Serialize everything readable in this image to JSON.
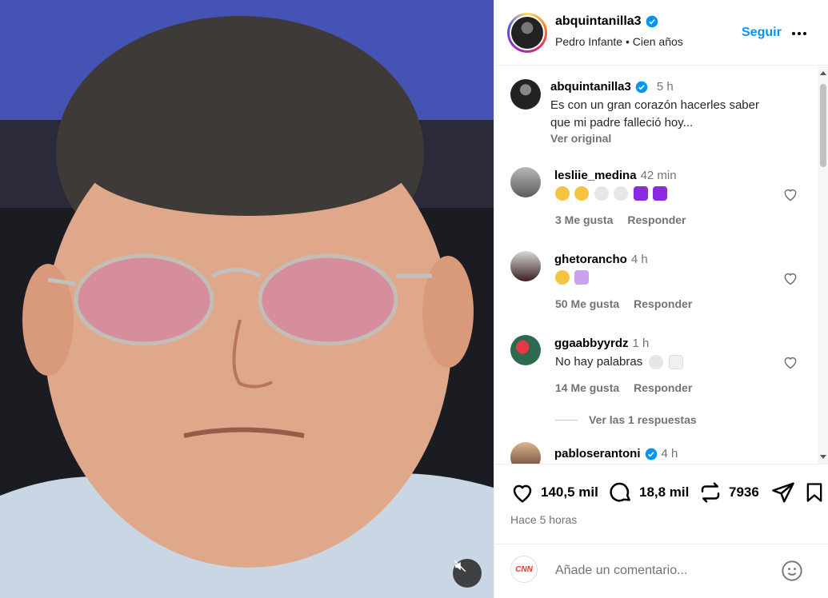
{
  "post": {
    "username": "abquintanilla3",
    "subtitle": "Pedro Infante • Cien años",
    "follow_label": "Seguir",
    "caption_user": "abquintanilla3",
    "caption_time": "5 h",
    "caption_text_1": "Es con un gran corazón hacerles saber",
    "caption_text_2": "que mi padre falleció hoy...",
    "see_original": "Ver original",
    "media_badge": "CNN"
  },
  "comments": [
    {
      "user": "lesliie_medina",
      "time": "42 min",
      "likes": "3 Me gusta",
      "reply": "Responder"
    },
    {
      "user": "ghetorancho",
      "time": "4 h",
      "likes": "50 Me gusta",
      "reply": "Responder"
    },
    {
      "user": "ggaabbyyrdz",
      "time": "1 h",
      "text": "No hay palabras",
      "likes": "14 Me gusta",
      "reply": "Responder"
    },
    {
      "user": "pabloserantoni",
      "time": "4 h"
    }
  ],
  "replies_label": "Ver las 1 respuestas",
  "stats": {
    "likes": "140,5 mil",
    "comments": "18,8 mil",
    "reposts": "7936",
    "posted": "Hace 5 horas"
  },
  "compose": {
    "placeholder": "Añade un comentario...",
    "avatar_label": "CNN"
  },
  "colors": {
    "accent": "#0095f6",
    "verified": "#0095f6"
  }
}
